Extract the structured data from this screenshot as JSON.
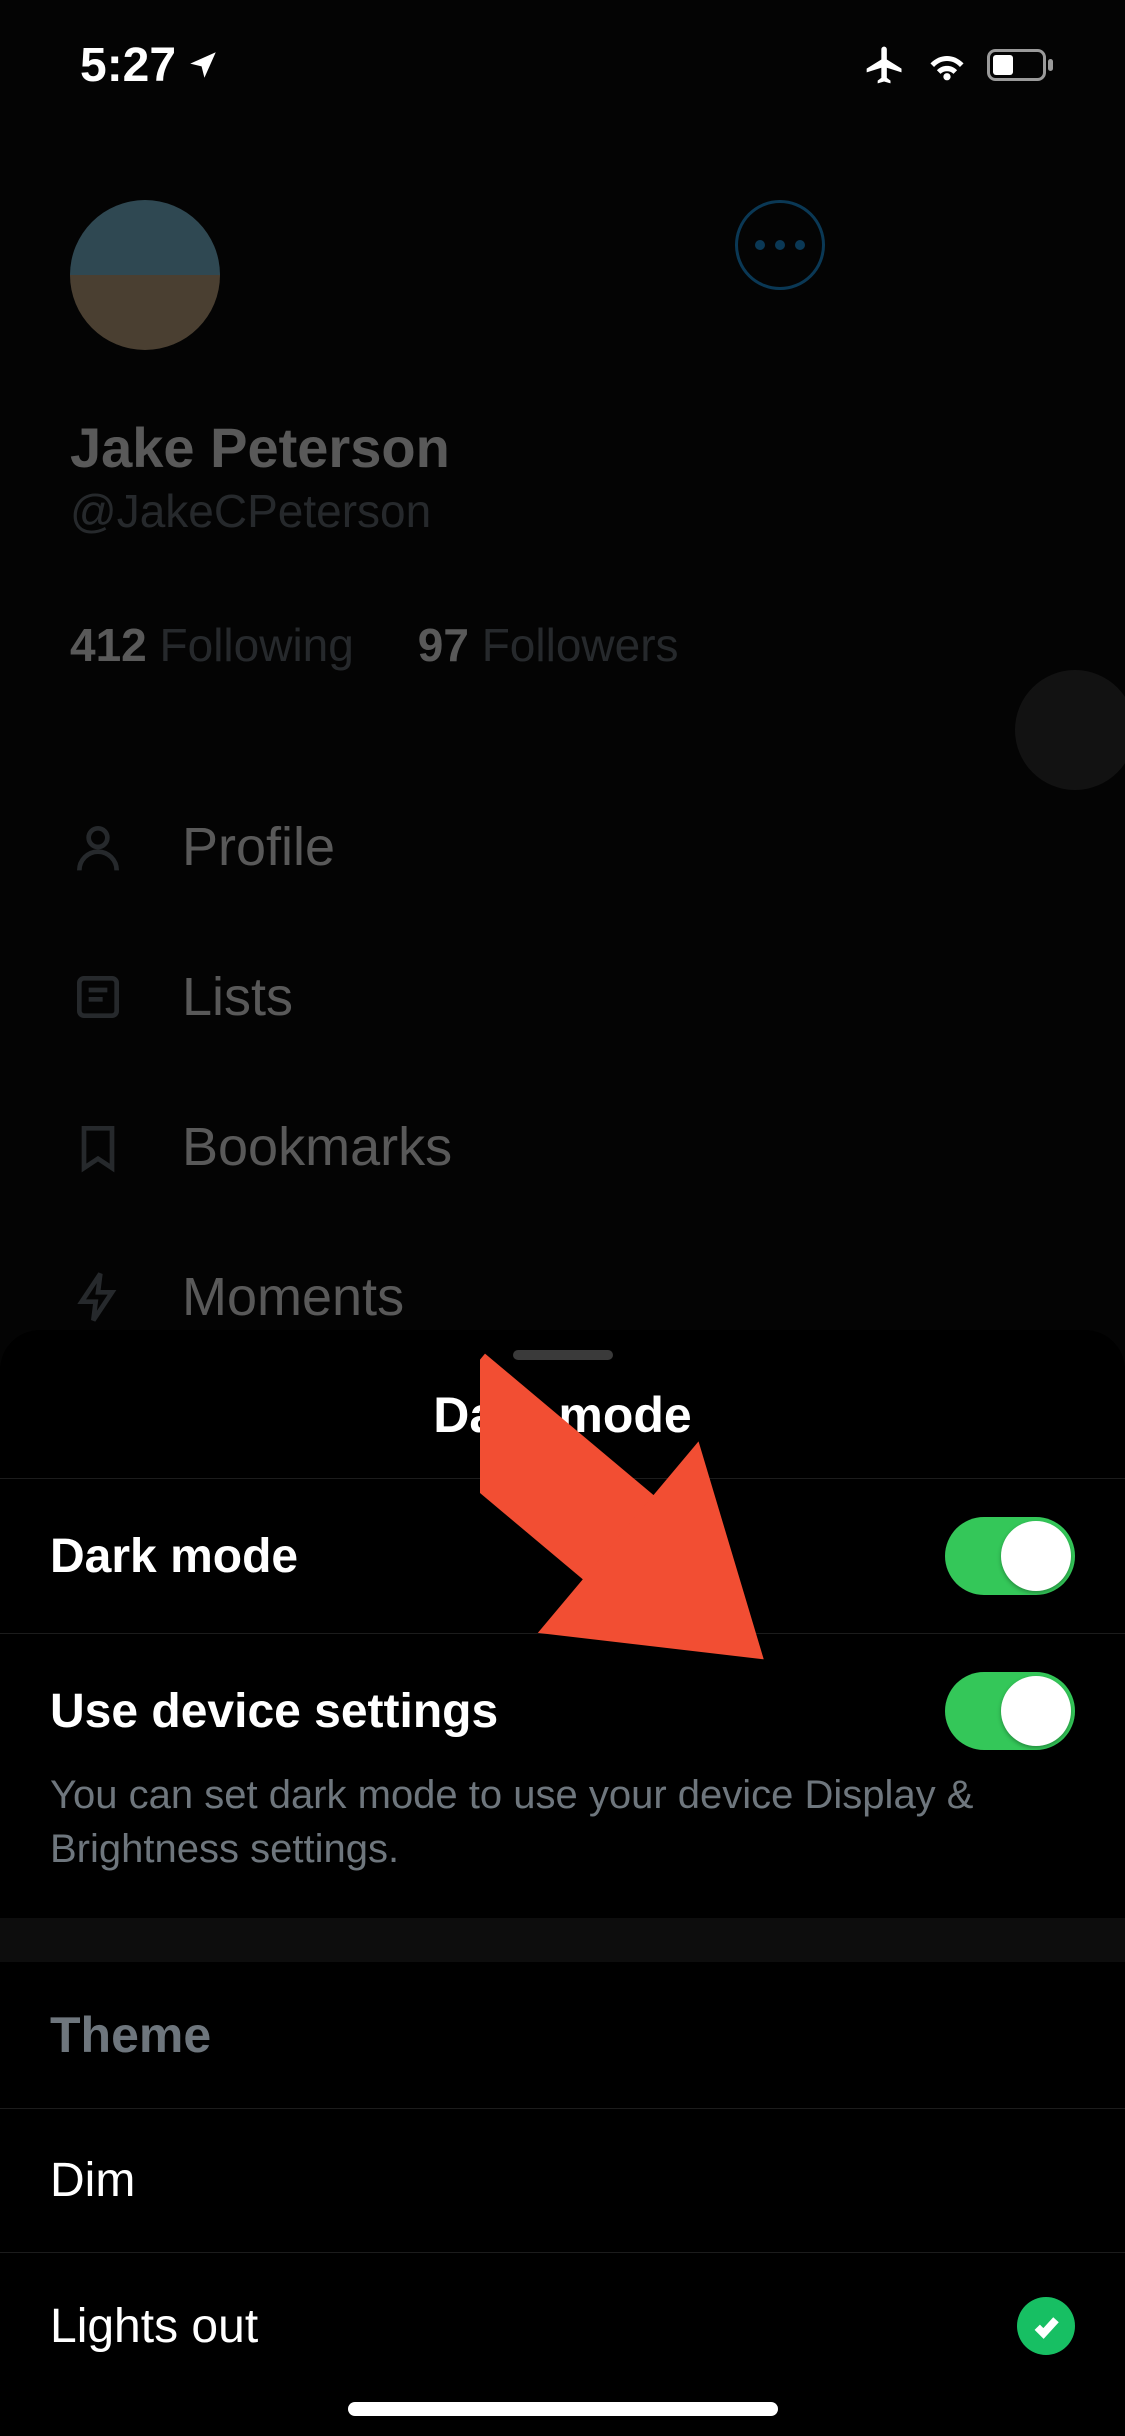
{
  "status": {
    "time": "5:27",
    "airplane": true,
    "wifi": true
  },
  "profile": {
    "display_name": "Jake Peterson",
    "handle": "@JakeCPeterson",
    "following_count": "412",
    "following_label": "Following",
    "followers_count": "97",
    "followers_label": "Followers"
  },
  "menu": {
    "items": [
      {
        "icon": "person",
        "label": "Profile"
      },
      {
        "icon": "list",
        "label": "Lists"
      },
      {
        "icon": "bookmark",
        "label": "Bookmarks"
      },
      {
        "icon": "moments",
        "label": "Moments"
      }
    ]
  },
  "sheet": {
    "title": "Dark mode",
    "dark_mode_label": "Dark mode",
    "dark_mode_on": true,
    "use_device_label": "Use device settings",
    "use_device_on": true,
    "use_device_desc": "You can set dark mode to use your device Display & Brightness settings.",
    "theme_header": "Theme",
    "theme_options": [
      {
        "label": "Dim",
        "selected": false
      },
      {
        "label": "Lights out",
        "selected": true
      }
    ]
  }
}
